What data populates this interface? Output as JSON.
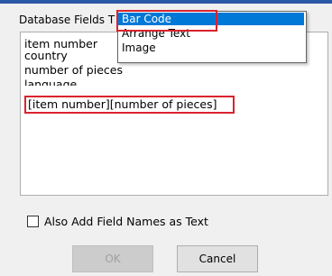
{
  "group": {
    "label": "Database Fields T"
  },
  "fields": [
    "item number",
    "country",
    "number of pieces",
    "language"
  ],
  "combined_field": "[item number][number of pieces]",
  "dropdown": {
    "items": [
      {
        "label": "Bar Code",
        "selected": true
      },
      {
        "label": "Arrange Text",
        "selected": false
      },
      {
        "label": "Image",
        "selected": false
      }
    ]
  },
  "checkbox": {
    "label": "Also Add Field Names as Text",
    "checked": false
  },
  "buttons": {
    "ok": "OK",
    "cancel": "Cancel"
  }
}
